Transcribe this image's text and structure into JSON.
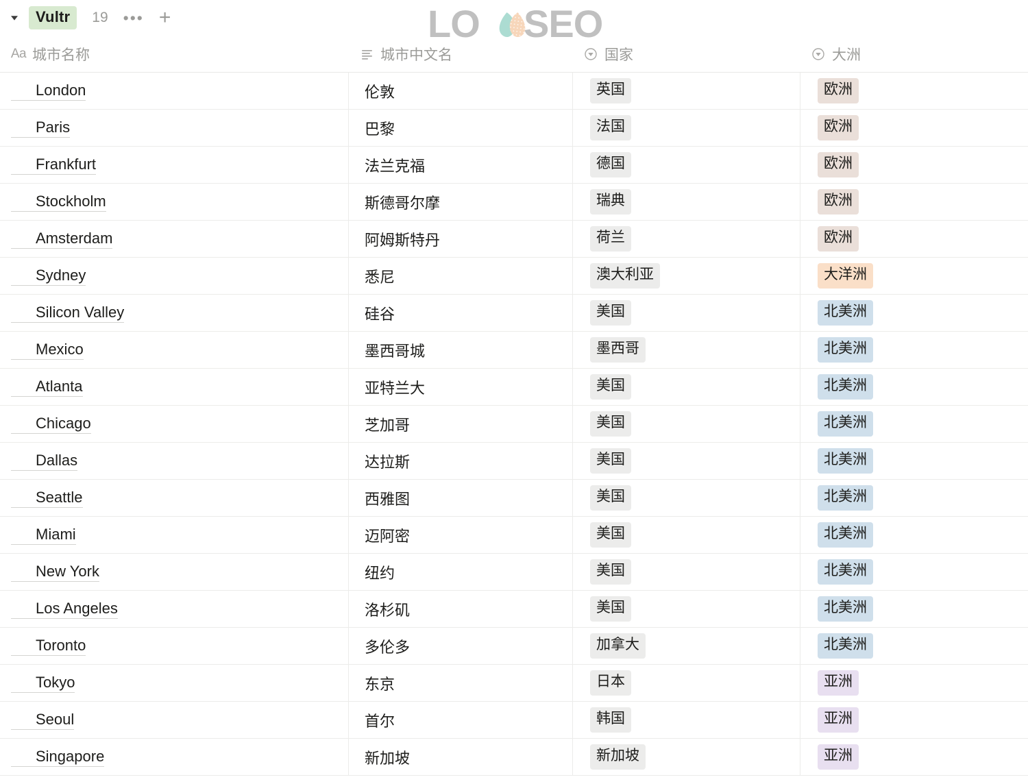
{
  "header": {
    "toggle_icon": "triangle-down-icon",
    "title": "Vultr",
    "count": "19",
    "more_icon": "•••",
    "add_icon": "+"
  },
  "watermark": {
    "text_left": "LO",
    "text_right": "SEO",
    "name": "loyseo-logo-watermark",
    "leaf_left_color": "#9ed7cb",
    "leaf_right_color": "#f6cfae",
    "text_color": "#b4b4b4"
  },
  "columns": [
    {
      "key": "city",
      "label": "城市名称",
      "icon": "title-aa-icon",
      "icon_glyph": "Aa"
    },
    {
      "key": "city_cn",
      "label": "城市中文名",
      "icon": "text-lines-icon",
      "icon_glyph": ""
    },
    {
      "key": "country",
      "label": "国家",
      "icon": "select-icon",
      "icon_glyph": ""
    },
    {
      "key": "continent",
      "label": "大洲",
      "icon": "select-icon",
      "icon_glyph": ""
    }
  ],
  "tag_colors": {
    "欧洲": "c-eu",
    "大洋洲": "c-oc",
    "北美洲": "c-na",
    "亚洲": "c-as"
  },
  "rows": [
    {
      "city": "London",
      "city_cn": "伦敦",
      "country": "英国",
      "continent": "欧洲"
    },
    {
      "city": "Paris",
      "city_cn": "巴黎",
      "country": "法国",
      "continent": "欧洲"
    },
    {
      "city": "Frankfurt",
      "city_cn": "法兰克福",
      "country": "德国",
      "continent": "欧洲"
    },
    {
      "city": "Stockholm",
      "city_cn": "斯德哥尔摩",
      "country": "瑞典",
      "continent": "欧洲"
    },
    {
      "city": "Amsterdam",
      "city_cn": "阿姆斯特丹",
      "country": "荷兰",
      "continent": "欧洲"
    },
    {
      "city": "Sydney",
      "city_cn": "悉尼",
      "country": "澳大利亚",
      "continent": "大洋洲"
    },
    {
      "city": "Silicon Valley",
      "city_cn": "硅谷",
      "country": "美国",
      "continent": "北美洲"
    },
    {
      "city": "Mexico",
      "city_cn": "墨西哥城",
      "country": "墨西哥",
      "continent": "北美洲"
    },
    {
      "city": "Atlanta",
      "city_cn": "亚特兰大",
      "country": "美国",
      "continent": "北美洲"
    },
    {
      "city": "Chicago",
      "city_cn": "芝加哥",
      "country": "美国",
      "continent": "北美洲"
    },
    {
      "city": "Dallas",
      "city_cn": "达拉斯",
      "country": "美国",
      "continent": "北美洲"
    },
    {
      "city": "Seattle",
      "city_cn": "西雅图",
      "country": "美国",
      "continent": "北美洲"
    },
    {
      "city": "Miami",
      "city_cn": "迈阿密",
      "country": "美国",
      "continent": "北美洲"
    },
    {
      "city": "New York",
      "city_cn": "纽约",
      "country": "美国",
      "continent": "北美洲"
    },
    {
      "city": "Los Angeles",
      "city_cn": "洛杉矶",
      "country": "美国",
      "continent": "北美洲"
    },
    {
      "city": "Toronto",
      "city_cn": "多伦多",
      "country": "加拿大",
      "continent": "北美洲"
    },
    {
      "city": "Tokyo",
      "city_cn": "东京",
      "country": "日本",
      "continent": "亚洲"
    },
    {
      "city": "Seoul",
      "city_cn": "首尔",
      "country": "韩国",
      "continent": "亚洲"
    },
    {
      "city": "Singapore",
      "city_cn": "新加坡",
      "country": "新加坡",
      "continent": "亚洲"
    }
  ]
}
